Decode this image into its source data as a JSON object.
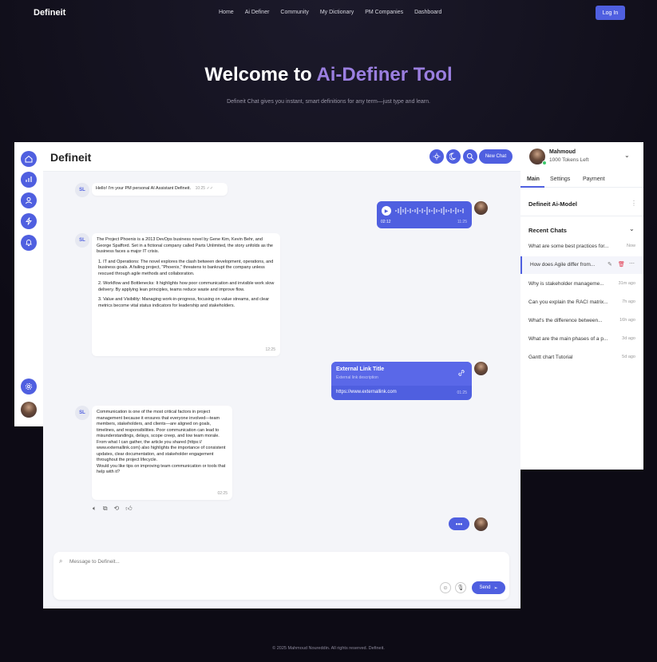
{
  "nav": {
    "brand": "Defineit",
    "links": [
      "Home",
      "Ai Definer",
      "Community",
      "My Dictionary",
      "PM Companies",
      "Dashboard"
    ],
    "login": "Log In"
  },
  "hero": {
    "title_main": "Welcome to ",
    "title_accent": "Ai-Definer Tool",
    "subtitle": "Defineit Chat gives you instant, smart definitions for any term—just type and learn."
  },
  "chat": {
    "title": "Defineit",
    "new_chat": "New Chat",
    "avatar_initials": "SL",
    "messages": {
      "m1_text": "Hello! I'm your PM personal AI Assistant Defineit.",
      "m1_time": "10:25",
      "audio_time_left": "02:12",
      "audio_time": "11:25",
      "m3_intro": "The Project Phoenix is a 2013 DevOps business novel by Gene Kim, Kevin Behr, and George Spafford. Set in a fictional company called Parts Unlimited, the story unfolds as the business faces a major IT crisis.",
      "m3_p1": "1.  IT and Operations: The novel explores the clash between development, operations, and business goals. A failing project, \"Phoenix,\" threatens to bankrupt the company unless rescued through agile methods and collaboration.",
      "m3_p2": "2.  Workflow and Bottlenecks: It highlights how poor communication and invisible work slow delivery. By applying lean principles, teams reduce waste and improve flow.",
      "m3_p3": "3.  Value and Visibility: Managing work-in-progress, focusing on value streams, and clear metrics become vital status indicators for leadership and stakeholders.",
      "m3_time": "12:25",
      "link_title": "External Link Title",
      "link_desc": "External link description",
      "link_url": "https://www.externallink.com",
      "link_time": "01:25",
      "m5_a": "Communication is one of the most critical factors in project management because it ensures that everyone involved—team members, stakeholders, and clients—are aligned on goals, timelines, and responsibilities. Poor communication can lead to misunderstandings, delays, scope creep, and low team morale.",
      "m5_b": "From what I can gather, the article you shared (https:// www.externallink.com) also highlights the importance of consistent updates, clear documentation, and stakeholder engagement throughout the project lifecycle.",
      "m5_c": "Would you like tips on improving team communication or tools that help with it?",
      "m5_time": "02:25",
      "typing": "•••"
    },
    "composer": {
      "placeholder": "Message to Defineit...",
      "send": "Send"
    }
  },
  "sidebar": {
    "user_name": "Mahmoud",
    "tokens": "1000 Tokens Left",
    "tabs": [
      "Main",
      "Settings",
      "Payment"
    ],
    "model": "Defineit Ai-Model",
    "recent_title": "Recent Chats",
    "recent": [
      {
        "title": "What are some best practices for...",
        "ago": "Now"
      },
      {
        "title": "How does Agile differ from...",
        "ago": ""
      },
      {
        "title": "Why is stakeholder manageme...",
        "ago": "31m ago"
      },
      {
        "title": "Can you explain the RACI matrix...",
        "ago": "7h ago"
      },
      {
        "title": "What's the difference between...",
        "ago": "16h ago"
      },
      {
        "title": "What are the main phases of a p...",
        "ago": "3d ago"
      },
      {
        "title": "Gantt chart Tutorial",
        "ago": "5d ago"
      }
    ]
  },
  "footer": "© 2025 Mahmoud Noureddin. All rights reserved. Defineit.",
  "colors": {
    "accent": "#4f5fe0",
    "hero_accent": "#9b7fe0",
    "background": "#0d0b15"
  },
  "icons": [
    "home-icon",
    "chart-icon",
    "user-icon",
    "bolt-icon",
    "bell-icon",
    "settings-icon",
    "sun-icon",
    "moon-icon",
    "search-icon",
    "paperclip-icon",
    "emoji-icon",
    "mic-icon",
    "send-icon",
    "link-icon",
    "chevron-down-icon",
    "edit-icon",
    "trash-icon",
    "more-icon",
    "speaker-icon",
    "copy-icon",
    "repeat-icon",
    "thumbs-up-icon",
    "play-icon"
  ]
}
